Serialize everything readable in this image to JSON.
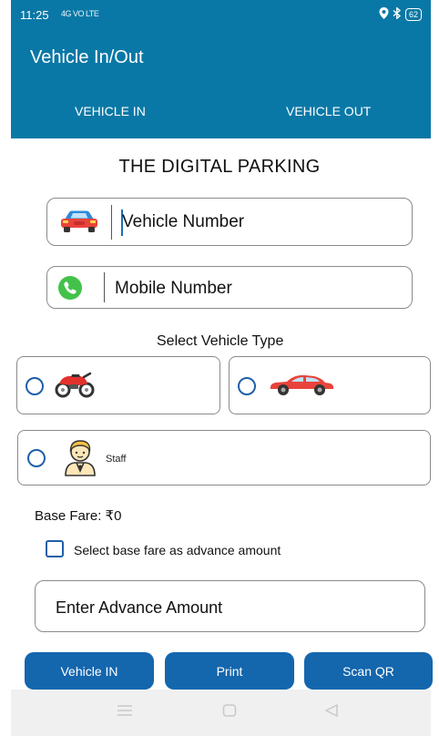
{
  "status": {
    "time": "11:25",
    "signal_text": "4G  VO LTE",
    "battery": "62"
  },
  "appbar": {
    "title": "Vehicle In/Out"
  },
  "tabs": [
    {
      "label": "VEHICLE IN"
    },
    {
      "label": "VEHICLE OUT"
    }
  ],
  "heading": "THE DIGITAL PARKING",
  "form": {
    "vehicle_number_placeholder": "Vehicle Number",
    "mobile_number_placeholder": "Mobile Number",
    "select_vehicle_type": "Select Vehicle Type",
    "vehicle_types": [
      {
        "icon": "motorcycle-icon",
        "label": "",
        "selected": false
      },
      {
        "icon": "car-icon",
        "label": "",
        "selected": false
      },
      {
        "icon": "staff-icon",
        "label": "Staff",
        "selected": false
      }
    ],
    "base_fare": "Base Fare: ₹0",
    "advance_checkbox_label": "Select base fare as advance amount",
    "advance_checked": false,
    "advance_amount_placeholder": "Enter Advance Amount"
  },
  "buttons": {
    "vehicle_in": "Vehicle IN",
    "print": "Print",
    "scan_qr": "Scan QR"
  },
  "colors": {
    "primary": "#0a78a6",
    "button": "#1466ad",
    "accent": "#1f5fa9"
  }
}
